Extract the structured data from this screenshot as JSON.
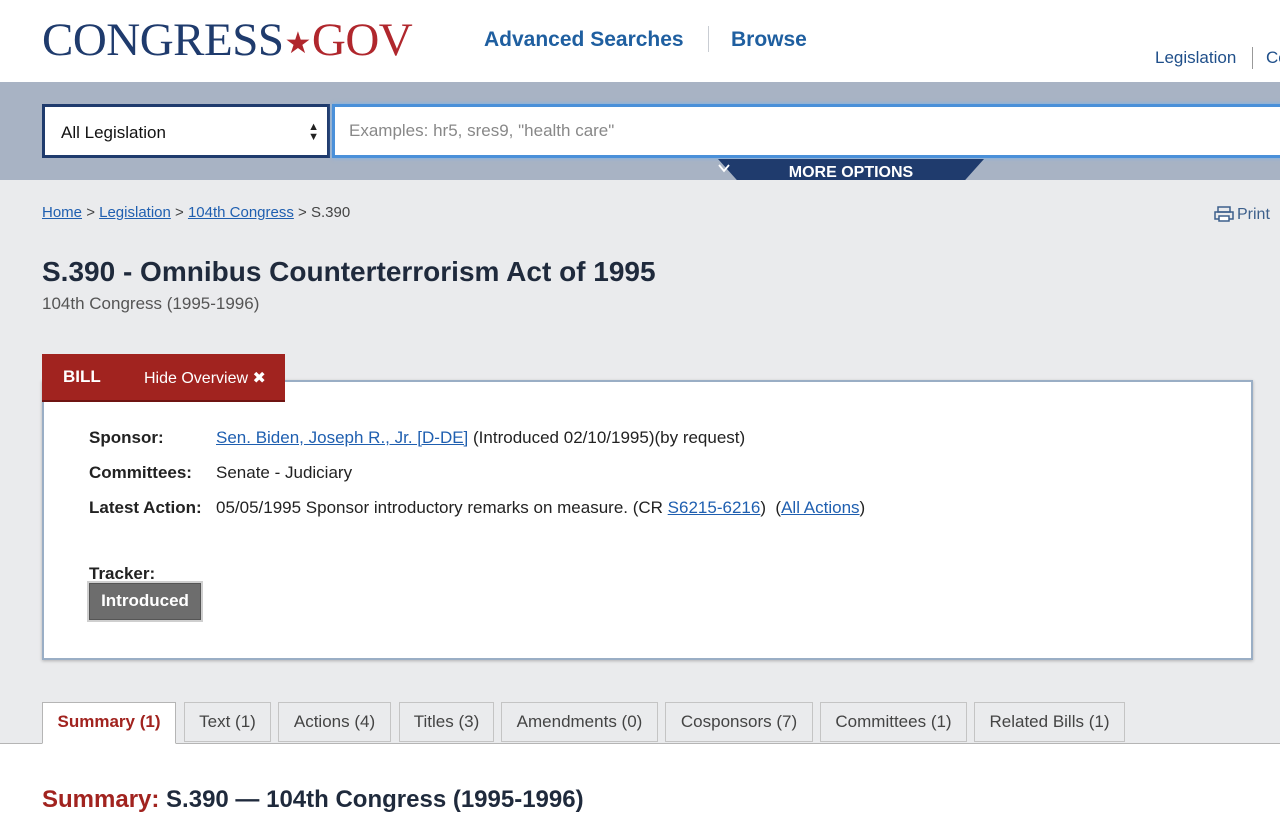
{
  "header": {
    "logo_main": "CONGRESS",
    "logo_dot": "★",
    "logo_gov": "GOV",
    "nav": [
      "Advanced Searches",
      "Browse"
    ],
    "util_links": [
      "Legislation",
      "Co"
    ]
  },
  "search": {
    "collection_value": "All Legislation",
    "placeholder": "Examples: hr5, sres9, \"health care\"",
    "value": "",
    "more_options": "MORE OPTIONS"
  },
  "breadcrumb": {
    "items": [
      "Home",
      "Legislation",
      "104th Congress"
    ],
    "current": "S.390",
    "separator": ">"
  },
  "print_label": "Print",
  "bill": {
    "title": "S.390 - Omnibus Counterterrorism Act of 1995",
    "congress": "104th Congress (1995-1996)",
    "type_label": "BILL",
    "hide_overview": "Hide Overview ✖",
    "sponsor_label": "Sponsor:",
    "sponsor_name": "Sen. Biden, Joseph R., Jr. [D-DE]",
    "sponsor_note": "(Introduced 02/10/1995)(by request)",
    "committees_label": "Committees:",
    "committees_value": "Senate - Judiciary",
    "latest_action_label": "Latest Action:",
    "latest_action_text": "05/05/1995 Sponsor introductory remarks on measure. (CR ",
    "latest_action_cr_link": "S6215-6216",
    "latest_action_mid": ")  (",
    "all_actions_link": "All Actions",
    "latest_action_end": ")",
    "tracker_label": "Tracker:",
    "tracker_status": "Introduced"
  },
  "tabs": [
    {
      "label": "Summary (1)",
      "active": true
    },
    {
      "label": "Text (1)",
      "active": false
    },
    {
      "label": "Actions (4)",
      "active": false
    },
    {
      "label": "Titles (3)",
      "active": false
    },
    {
      "label": "Amendments (0)",
      "active": false
    },
    {
      "label": "Cosponsors (7)",
      "active": false
    },
    {
      "label": "Committees (1)",
      "active": false
    },
    {
      "label": "Related Bills (1)",
      "active": false
    }
  ],
  "summary": {
    "label": "Summary:",
    "heading": "S.390 — 104th Congress (1995-1996)"
  },
  "colors": {
    "brand_navy": "#1f3b6d",
    "brand_red": "#a1231f",
    "link_blue": "#1f5fb0",
    "search_band": "#a8b3c4"
  }
}
